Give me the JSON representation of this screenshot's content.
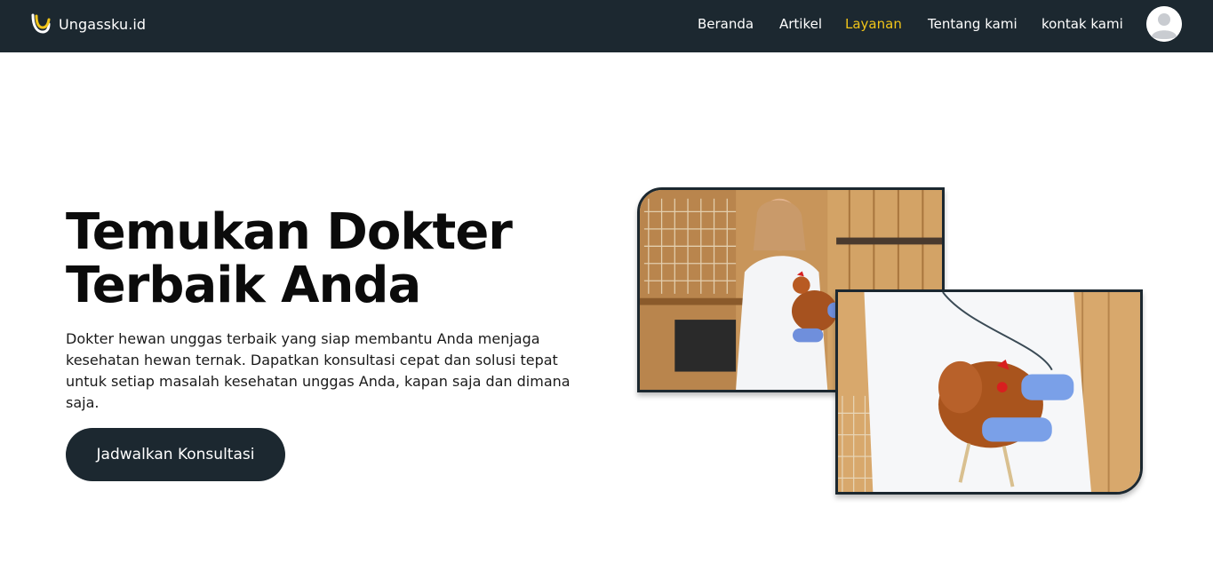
{
  "header": {
    "brand": "Ungassku.id",
    "nav": [
      {
        "label": "Beranda",
        "active": false
      },
      {
        "label": "Artikel",
        "active": false
      },
      {
        "label": "Layanan",
        "active": true
      },
      {
        "label": "Tentang kami",
        "active": false
      },
      {
        "label": "kontak kami",
        "active": false
      }
    ],
    "icons": {
      "logo": "brand-logo-icon",
      "avatar": "user-avatar-icon"
    }
  },
  "hero": {
    "title_line1": "Temukan Dokter",
    "title_line2": "Terbaik Anda",
    "description": "Dokter hewan unggas terbaik yang siap membantu Anda menjaga kesehatan hewan ternak. Dapatkan konsultasi cepat dan solusi tepat untuk setiap masalah kesehatan unggas Anda, kapan saja dan dimana saja.",
    "cta_label": "Jadwalkan Konsultasi"
  },
  "colors": {
    "navbar": "#1c2830",
    "active_link": "#f0c419",
    "button": "#1c2830"
  }
}
